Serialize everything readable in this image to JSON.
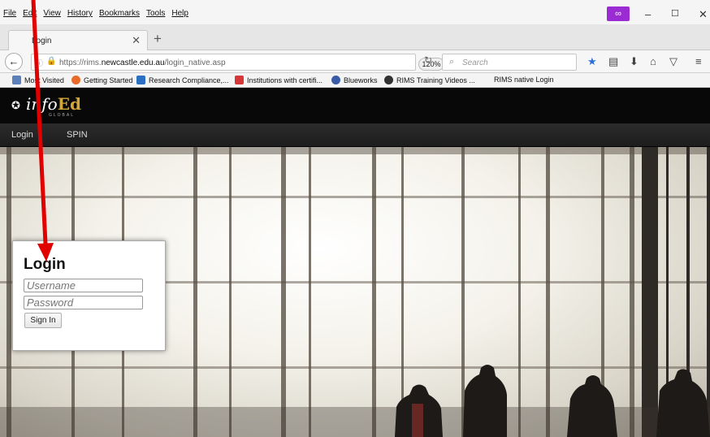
{
  "browser": {
    "menu": [
      "File",
      "Edit",
      "View",
      "History",
      "Bookmarks",
      "Tools",
      "Help"
    ],
    "window_controls": {
      "minimize": "–",
      "maximize": "☐",
      "close": "✕"
    },
    "tab": {
      "title": "Login",
      "close": "✕"
    },
    "new_tab": "+",
    "url": {
      "prefix": "https://rims.",
      "domain": "newcastle.edu.au",
      "path": "/login_native.asp"
    },
    "zoom": "120%",
    "search_placeholder": "Search",
    "bookmarks": [
      {
        "label": "Most Visited",
        "color": "#5b7fb8"
      },
      {
        "label": "Getting Started",
        "color": "#e8692a"
      },
      {
        "label": "Research Compliance,...",
        "color": "#2b6fc2"
      },
      {
        "label": "Institutions with certifi...",
        "color": "#d8373a"
      },
      {
        "label": "Blueworks",
        "color": "#3a5ca8"
      },
      {
        "label": "RIMS Training Videos ...",
        "color": "#333333"
      },
      {
        "label": "RIMS native Login",
        "color": "#ffffff"
      }
    ]
  },
  "site": {
    "logo_main": "info",
    "logo_accent": "Ed",
    "logo_sub": "GLOBAL",
    "nav": [
      "Login",
      "SPIN"
    ],
    "accent_color": "#d4a73a"
  },
  "login": {
    "title": "Login",
    "username_placeholder": "Username",
    "password_placeholder": "Password",
    "submit_label": "Sign In"
  },
  "annotation": {
    "arrow_color": "#e00000"
  }
}
